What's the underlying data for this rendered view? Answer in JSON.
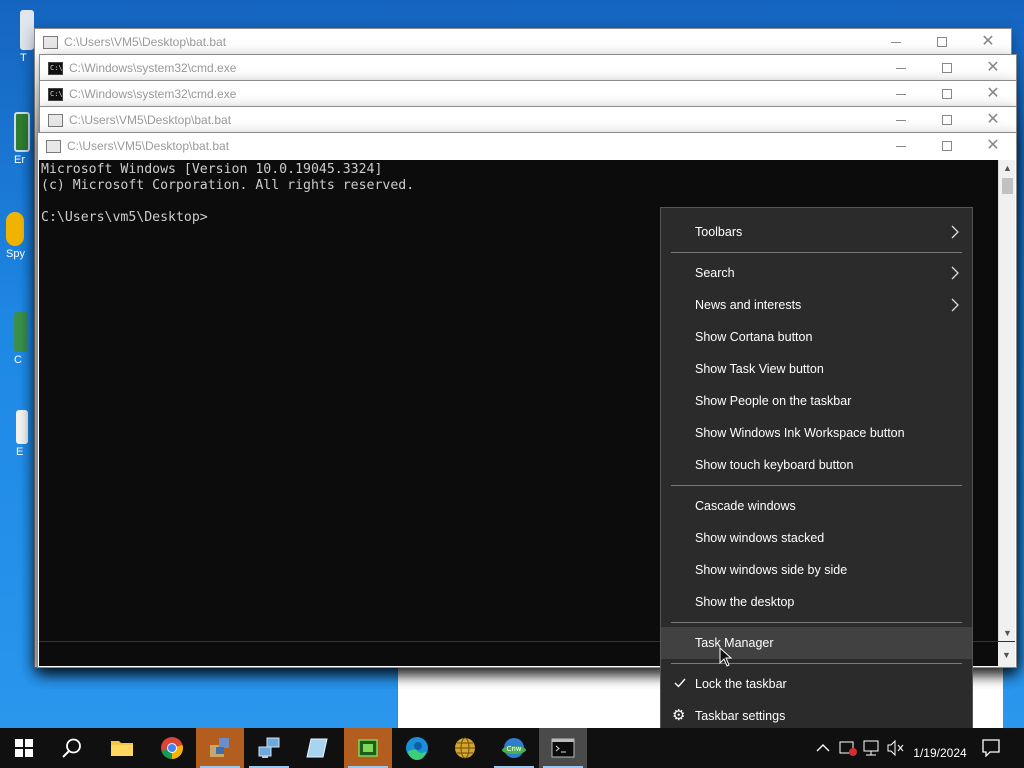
{
  "windows": [
    {
      "title": "C:\\Users\\VM5\\Desktop\\bat.bat"
    },
    {
      "title": "C:\\Windows\\system32\\cmd.exe"
    },
    {
      "title": "C:\\Windows\\system32\\cmd.exe"
    },
    {
      "title": "C:\\Users\\VM5\\Desktop\\bat.bat"
    },
    {
      "title": "C:\\Users\\VM5\\Desktop\\bat.bat"
    }
  ],
  "console": {
    "lines": [
      "Microsoft Windows [Version 10.0.19045.3324]",
      "(c) Microsoft Corporation. All rights reserved.",
      "",
      "C:\\Users\\vm5\\Desktop>"
    ]
  },
  "desktop_icons": [
    {
      "label": "T"
    },
    {
      "label": "Er"
    },
    {
      "label": "Spy"
    },
    {
      "label": "C"
    },
    {
      "label": "E"
    }
  ],
  "context_menu": {
    "items": [
      {
        "label": "Toolbars"
      },
      {
        "label": "Search"
      },
      {
        "label": "News and interests"
      },
      {
        "label": "Show Cortana button"
      },
      {
        "label": "Show Task View button"
      },
      {
        "label": "Show People on the taskbar"
      },
      {
        "label": "Show Windows Ink Workspace button"
      },
      {
        "label": "Show touch keyboard button"
      },
      {
        "label": "Cascade windows"
      },
      {
        "label": "Show windows stacked"
      },
      {
        "label": "Show windows side by side"
      },
      {
        "label": "Show the desktop"
      },
      {
        "label": "Task Manager"
      },
      {
        "label": "Lock the taskbar"
      },
      {
        "label": "Taskbar settings"
      }
    ]
  },
  "taskbar": {
    "clock_date": "1/19/2024",
    "apps": [
      "start",
      "search",
      "file-explorer",
      "chrome",
      "app-1",
      "app-2",
      "app-3",
      "app-4",
      "edge",
      "app-5",
      "app-6",
      "cmd"
    ]
  }
}
